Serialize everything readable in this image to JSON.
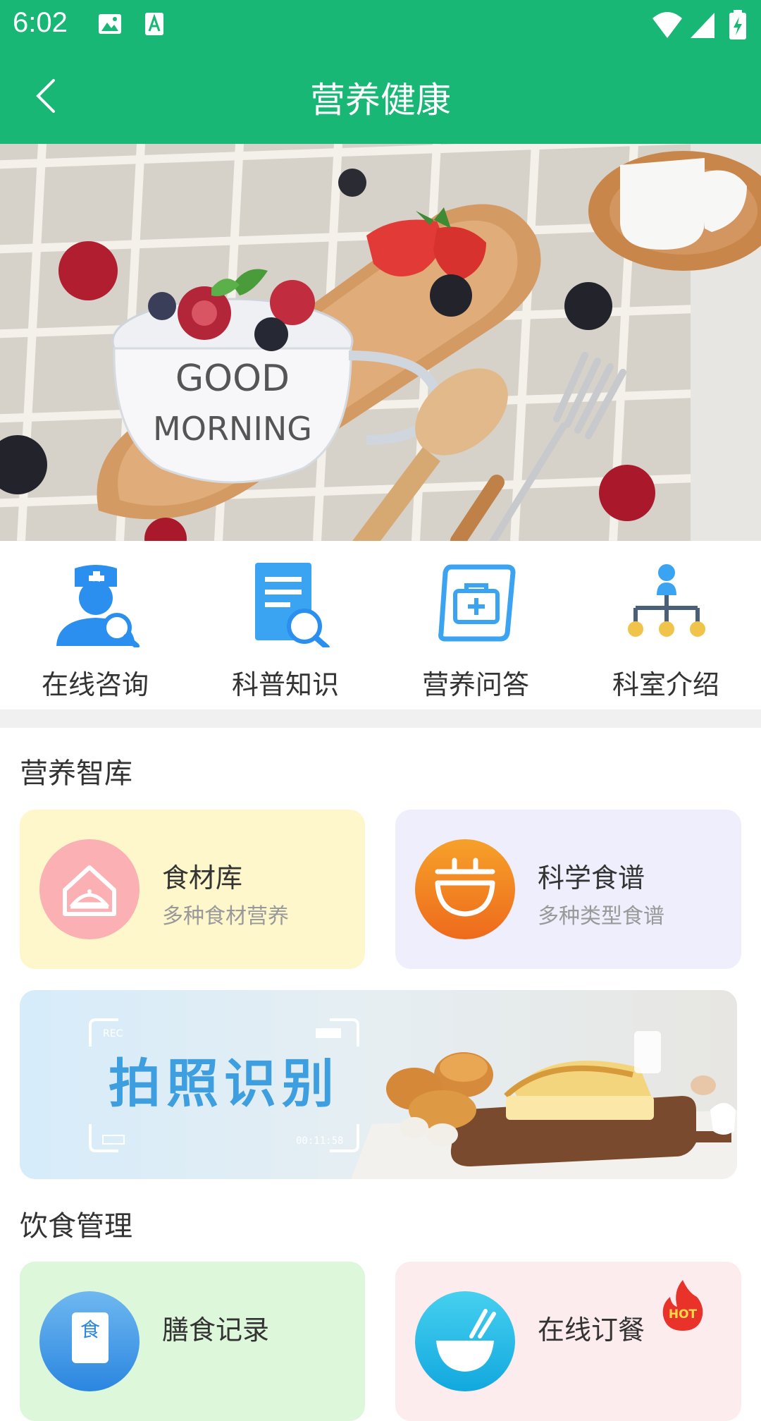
{
  "status_bar": {
    "time": "6:02"
  },
  "app_bar": {
    "title": "营养健康"
  },
  "hero": {
    "mug_text_1": "GOOD",
    "mug_text_2": "MORNING"
  },
  "quick_menu": [
    {
      "label": "在线咨询",
      "icon": "doctor-search-icon"
    },
    {
      "label": "科普知识",
      "icon": "document-search-icon"
    },
    {
      "label": "营养问答",
      "icon": "medical-kit-icon"
    },
    {
      "label": "科室介绍",
      "icon": "org-chart-icon"
    }
  ],
  "nutrition_library": {
    "title": "营养智库",
    "cards": [
      {
        "title": "食材库",
        "subtitle": "多种食材营养",
        "bg": "#fff7cc",
        "icon": "food-cover-icon"
      },
      {
        "title": "科学食谱",
        "subtitle": "多种类型食谱",
        "bg": "#eeeefc",
        "icon": "bowl-icon"
      }
    ],
    "photo_banner": {
      "text": "拍照识别",
      "rec_label": "REC",
      "timer": "00:11:58"
    }
  },
  "diet_management": {
    "title": "饮食管理",
    "cards": [
      {
        "title": "膳食记录",
        "icon_text": "食",
        "bg": "#ddf7db",
        "icon": "record-book-icon"
      },
      {
        "title": "在线订餐",
        "badge": "HOT",
        "bg": "#fcecee",
        "icon": "meal-bowl-icon"
      }
    ]
  },
  "colors": {
    "primary": "#18b775",
    "blue": "#2b8ff0",
    "orange": "#f08a1c"
  }
}
